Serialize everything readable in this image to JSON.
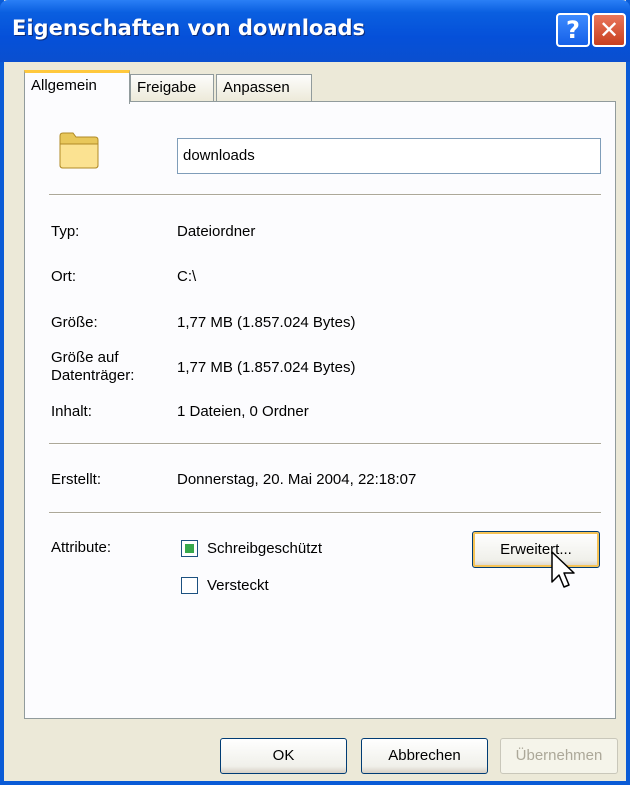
{
  "window": {
    "title": "Eigenschaften von downloads",
    "help_glyph": "?",
    "close_glyph": "✕"
  },
  "tabs": [
    {
      "label": "Allgemein",
      "active": true
    },
    {
      "label": "Freigabe",
      "active": false
    },
    {
      "label": "Anpassen",
      "active": false
    }
  ],
  "general": {
    "folder_icon": "folder-icon",
    "name": "downloads",
    "rows": [
      {
        "label": "Typ:",
        "value": "Dateiordner"
      },
      {
        "label": "Ort:",
        "value": "C:\\"
      },
      {
        "label": "Größe:",
        "value": "1,77 MB (1.857.024 Bytes)"
      },
      {
        "label": "Größe auf Datenträger:",
        "value": "1,77 MB (1.857.024 Bytes)"
      },
      {
        "label": "Inhalt:",
        "value": "1 Dateien, 0 Ordner"
      }
    ],
    "created": {
      "label": "Erstellt:",
      "value": "Donnerstag, 20. Mai 2004, 22:18:07"
    },
    "attributes": {
      "label": "Attribute:",
      "readonly": {
        "label": "Schreibgeschützt",
        "state": "indeterminate"
      },
      "hidden": {
        "label": "Versteckt",
        "checked": false
      },
      "advanced_button": "Erweitert..."
    }
  },
  "buttons": {
    "ok": "OK",
    "cancel": "Abbrechen",
    "apply": "Übernehmen"
  },
  "colors": {
    "title_bar": "#0a5fe0",
    "dialog_bg": "#ece9d8",
    "panel_bg": "#fcfcfe",
    "check_fill": "#37a84c"
  }
}
